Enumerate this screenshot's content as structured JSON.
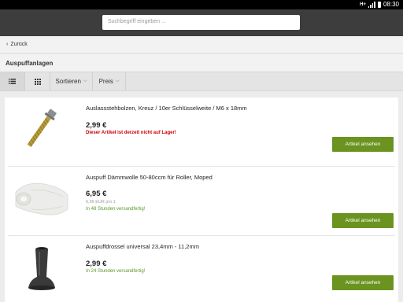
{
  "status": {
    "network": "H+",
    "time": "08:30"
  },
  "search": {
    "placeholder": "Suchbegriff eingeben ..."
  },
  "nav": {
    "back_label": "Zurück"
  },
  "category": {
    "title": "Auspuffanlagen"
  },
  "toolbar": {
    "sort_label": "Sortieren",
    "price_label": "Preis"
  },
  "products": [
    {
      "name": "Auslassstehbolzen, Kreuz / 10er Schlüsselweite / M6 x 18mm",
      "price": "2,99 €",
      "availability": "Dieser Artikel ist derzeit nicht auf Lager!",
      "availability_status": "out-of-stock",
      "button": "Artikel ansehen"
    },
    {
      "name": "Auspuff Dämmwolle 50-80ccm für Roller, Moped",
      "price": "6,95 €",
      "unit_price": "6,95 EUR pro 1",
      "availability": "In 48 Stunden versandfertig!",
      "availability_status": "in-stock",
      "button": "Artikel ansehen"
    },
    {
      "name": "Auspuffdrossel universal 23,4mm - 11,2mm",
      "price": "2,99 €",
      "availability": "In 24 Stunden versandfertig!",
      "availability_status": "in-stock",
      "button": "Artikel ansehen"
    }
  ],
  "colors": {
    "accent": "#6b931f",
    "out_of_stock": "#cc0000",
    "in_stock": "#5b9a28",
    "topbar": "#3d3d3d"
  },
  "icons": [
    "chevron-left-icon",
    "list-view-icon",
    "grid-view-icon",
    "chevron-down-icon",
    "signal-icon",
    "battery-icon"
  ]
}
